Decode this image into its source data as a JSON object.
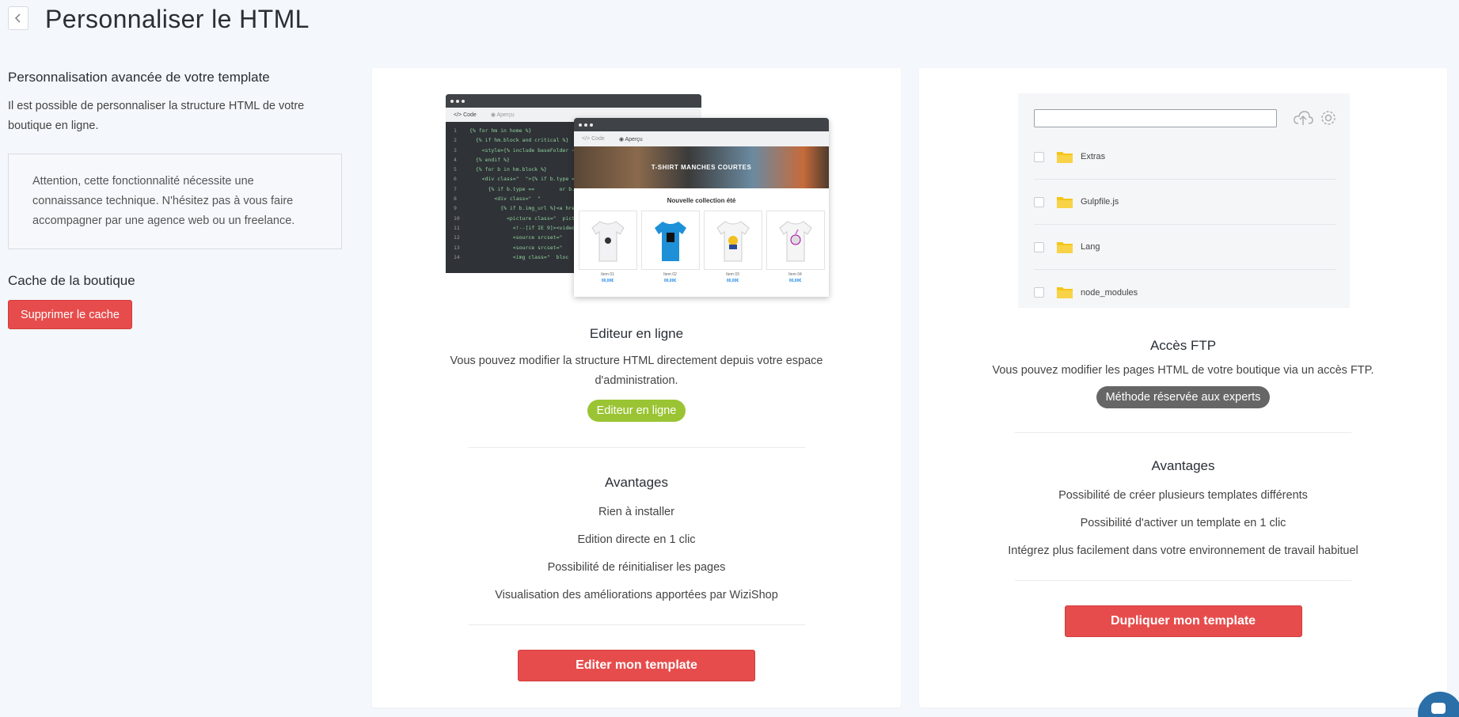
{
  "header": {
    "title": "Personnaliser le HTML",
    "back_icon": "chevron-left-icon"
  },
  "left": {
    "heading": "Personnalisation avancée de votre template",
    "description": "Il est possible de personnaliser la structure HTML de votre boutique en ligne.",
    "warning": "Attention, cette fonctionnalité nécessite une connaissance technique. N'hésitez pas à vous faire accompagner par une agence web ou un freelance.",
    "cache_heading": "Cache de la boutique",
    "cache_button": "Supprimer le cache"
  },
  "editor_card": {
    "mockup": {
      "tab_code": "Code",
      "tab_preview": "Aperçu",
      "code_lines": [
        "{% for hm in home %}",
        "  {% if hm.block and critical %}",
        "    <style>{% include baseFolder ~",
        "  {% endif %}",
        "  {% for b in hm.block %}",
        "    <div class=\"  \">{% if b.type ==",
        "      {% if b.type ==        or b.t",
        "        <div class=\"  \"",
        "          {% if b.img_url %}<a hre",
        "            <picture class=\"  pict",
        "              <!--[if IE 9]><video",
        "              <source srcset=\"",
        "              <source srcset=\"",
        "              <img class=\"  bloc"
      ],
      "banner": "T-SHIRT MANCHES COURTES",
      "collection": "Nouvelle collection été",
      "items": [
        {
          "name": "Item 01",
          "price": "00,00€"
        },
        {
          "name": "Item 02",
          "price": "00,00€"
        },
        {
          "name": "Item 03",
          "price": "00,00€"
        },
        {
          "name": "Item 04",
          "price": "00,00€"
        }
      ]
    },
    "title": "Editeur en ligne",
    "description": "Vous pouvez modifier la structure HTML directement depuis votre espace d'administration.",
    "badge": "Editeur en ligne",
    "advantages_title": "Avantages",
    "advantages": [
      "Rien à installer",
      "Edition directe en 1 clic",
      "Possibilité de réinitialiser les pages",
      "Visualisation des améliorations apportées par WiziShop"
    ],
    "button": "Editer mon template"
  },
  "ftp_card": {
    "mockup": {
      "files": [
        "Extras",
        "Gulpfile.js",
        "Lang",
        "node_modules"
      ]
    },
    "title": "Accès FTP",
    "description": "Vous pouvez modifier les pages HTML de votre boutique via un accès FTP.",
    "badge": "Méthode réservée aux experts",
    "advantages_title": "Avantages",
    "advantages": [
      "Possibilité de créer plusieurs templates différents",
      "Possibilité d'activer un template en 1 clic",
      "Intégrez plus facilement dans votre environnement de travail habituel"
    ],
    "button": "Dupliquer mon template"
  },
  "colors": {
    "accent_red": "#e74c4c",
    "accent_green": "#9ac433",
    "badge_grey": "#666666"
  }
}
